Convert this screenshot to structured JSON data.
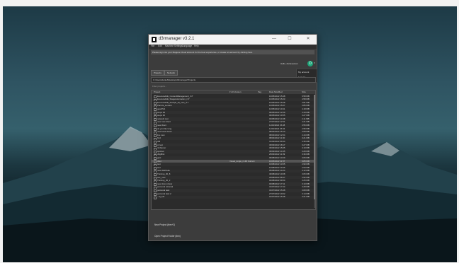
{
  "window": {
    "title": "d3rmanager  v3.2.1",
    "minimize": "—",
    "maximize": "☐",
    "close": "✕"
  },
  "menu": [
    "File",
    "Edit",
    "Machine Settings",
    "Language",
    "Help"
  ],
  "notice": "Please sign into your Maguse Cloud account for the best experience, or create an account by clicking here",
  "account": {
    "hello": "Hello, daniel jones",
    "initial": "D",
    "arrow": "▾",
    "dropdown": [
      "My account",
      "Log out"
    ]
  },
  "tabs": [
    "Projects",
    "Network"
  ],
  "path": "C:\\Users\\daniel\\Desktop\\d3manager\\Projects",
  "filter_label": "Filter projects...",
  "table": {
    "headers": {
      "project": "Project",
      "version": "▾ d3 Version",
      "tag": "Tag",
      "modified": "Date Modified",
      "size": "Size"
    },
    "rows": [
      {
        "name": "ExecutedAE_ContentManagement_r17",
        "version": "",
        "date": "16/05/2022 15:48",
        "size": "6.58 MB",
        "selected": false
      },
      {
        "name": "ExecutedAE_StageAutomation_r17",
        "version": "",
        "date": "16/05/2022 15:23",
        "size": "4.58 MB",
        "selected": false
      },
      {
        "name": "ExecutedAE_Sockpit_all_new_r17",
        "version": "",
        "date": "16/05/2022 15:08",
        "size": "3.81 MB",
        "selected": false
      },
      {
        "name": "Parrots_London",
        "version": "",
        "date": "16/05/2022 15:07",
        "size": "2.85 MB",
        "selected": false
      },
      {
        "name": "gavcP21",
        "version": "",
        "date": "10/05/2022 10:41",
        "size": "4.18 MB",
        "selected": false
      },
      {
        "name": "steps 39",
        "version": "",
        "date": "06/05/2022 12:09",
        "size": "3.44 MB",
        "selected": false
      },
      {
        "name": "steps 30",
        "version": "",
        "date": "06/05/2022 10:55",
        "size": "3.27 MB",
        "selected": false
      },
      {
        "name": "network test",
        "version": "",
        "date": "04/05/2022 14:38",
        "size": "2.11 MB",
        "selected": false
      },
      {
        "name": "new new client",
        "version": "",
        "date": "27/07/2022 12:51",
        "size": "4.21 MB",
        "selected": false
      },
      {
        "name": "new client",
        "version": "",
        "date": "11/04/2022 15:28",
        "size": "3.55 MB",
        "selected": false
      },
      {
        "name": "do you like long",
        "version": "",
        "date": "11/04/2022 15:04",
        "size": "2.95 MB",
        "selected": false
      },
      {
        "name": "new boots fresh",
        "version": "",
        "date": "08/04/2022 15:13",
        "size": "3.08 MB",
        "selected": false
      },
      {
        "name": "live new",
        "version": "",
        "date": "08/04/2022 12:04",
        "size": "2.44 MB",
        "selected": false
      },
      {
        "name": "fmd",
        "version": "",
        "date": "08/04/2022 11:00",
        "size": "3.21 MB",
        "selected": false
      },
      {
        "name": "OB",
        "version": "",
        "date": "31/03/2022 09:44",
        "size": "3.35 MB",
        "selected": false
      },
      {
        "name": "cr test",
        "version": "",
        "date": "30/03/2022 18:17",
        "size": "3.27 MB",
        "selected": false
      },
      {
        "name": "rimbamer",
        "version": "",
        "date": "30/03/2022 15:05",
        "size": "3.19 MB",
        "selected": false
      },
      {
        "name": "spotnet",
        "version": "",
        "date": "30/03/2022 14:35",
        "size": "3.29 MB",
        "selected": false
      },
      {
        "name": "d3g8irst",
        "version": "",
        "date": "29/03/2022 11:09",
        "size": "3.36 MB",
        "selected": false
      },
      {
        "name": "gavi",
        "version": "",
        "date": "06/08/2022 13:29",
        "size": "3.05 MB",
        "selected": false
      },
      {
        "name": "d3et",
        "version": "Visual_Angle_r4.48 Current",
        "date": "18/05/2022 11:57",
        "size": "6.85 MB",
        "selected": true
      },
      {
        "name": "test",
        "version": "",
        "date": "18/08/2022 13:05",
        "size": "2.90 MB",
        "selected": false
      },
      {
        "name": "test",
        "version": "",
        "date": "10/08/2022 10:46",
        "size": "2.94 MB",
        "selected": false
      },
      {
        "name": "new distribute",
        "version": "",
        "date": "05/08/2022 14:24",
        "size": "3.12 MB",
        "selected": false
      },
      {
        "name": "Training_30_8",
        "version": "",
        "date": "30/08/2022 10:08",
        "size": "3.05 MB",
        "selected": false
      },
      {
        "name": "sdc_new",
        "version": "",
        "date": "29/08/2022 08:47",
        "size": "2.92 MB",
        "selected": false
      },
      {
        "name": "Training_30_2",
        "version": "",
        "date": "04/08/2022 09:50",
        "size": "3.25 MB",
        "selected": false
      },
      {
        "name": "new vision show",
        "version": "",
        "date": "03/08/2022 17:11",
        "size": "3.10 MB",
        "selected": false
      },
      {
        "name": "personal retrieval",
        "version": "",
        "date": "31/07/2022 17:24",
        "size": "3.28 MB",
        "selected": false
      },
      {
        "name": "personal task",
        "version": "",
        "date": "31/07/2022 15:48",
        "size": "3.08 MB",
        "selected": false
      },
      {
        "name": "personal task 2",
        "version": "",
        "date": "27/07/2022 10:02",
        "size": "3.14 MB",
        "selected": false
      },
      {
        "name": "- my job",
        "version": "",
        "date": "01/07/2022 15:48",
        "size": "3.21 MB",
        "selected": false
      }
    ]
  },
  "footer": {
    "new_project": "New Project (tbm+2)",
    "open_folder": "Open Project Folder (tbm)"
  }
}
